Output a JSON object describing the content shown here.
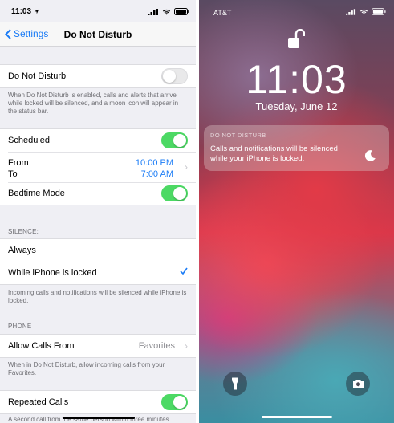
{
  "settings": {
    "status_time": "11:03",
    "nav": {
      "back_label": "Settings",
      "title": "Do Not Disturb"
    },
    "dnd": {
      "label": "Do Not Disturb",
      "enabled": false,
      "footer": "When Do Not Disturb is enabled, calls and alerts that arrive while locked will be silenced, and a moon icon will appear in the status bar."
    },
    "schedule": {
      "scheduled_label": "Scheduled",
      "scheduled_on": true,
      "from_label": "From",
      "to_label": "To",
      "from_value": "10:00 PM",
      "to_value": "7:00 AM",
      "bedtime_label": "Bedtime Mode",
      "bedtime_on": true
    },
    "silence": {
      "header": "SILENCE:",
      "always_label": "Always",
      "locked_label": "While iPhone is locked",
      "footer": "Incoming calls and notifications will be silenced while iPhone is locked."
    },
    "phone": {
      "header": "PHONE",
      "allow_label": "Allow Calls From",
      "allow_value": "Favorites",
      "allow_footer": "When in Do Not Disturb, allow incoming calls from your Favorites.",
      "repeated_label": "Repeated Calls",
      "repeated_on": true,
      "repeated_footer": "A second call from the same person within three minutes"
    }
  },
  "lockscreen": {
    "carrier": "AT&T",
    "time": "11:03",
    "date": "Tuesday, June 12",
    "notification": {
      "title": "DO NOT DISTURB",
      "body": "Calls and notifications will be silenced while your iPhone is locked."
    }
  },
  "colors": {
    "ios_blue": "#1b7cf6",
    "toggle_on": "#4cd964",
    "grouped_bg": "#efeff4"
  }
}
